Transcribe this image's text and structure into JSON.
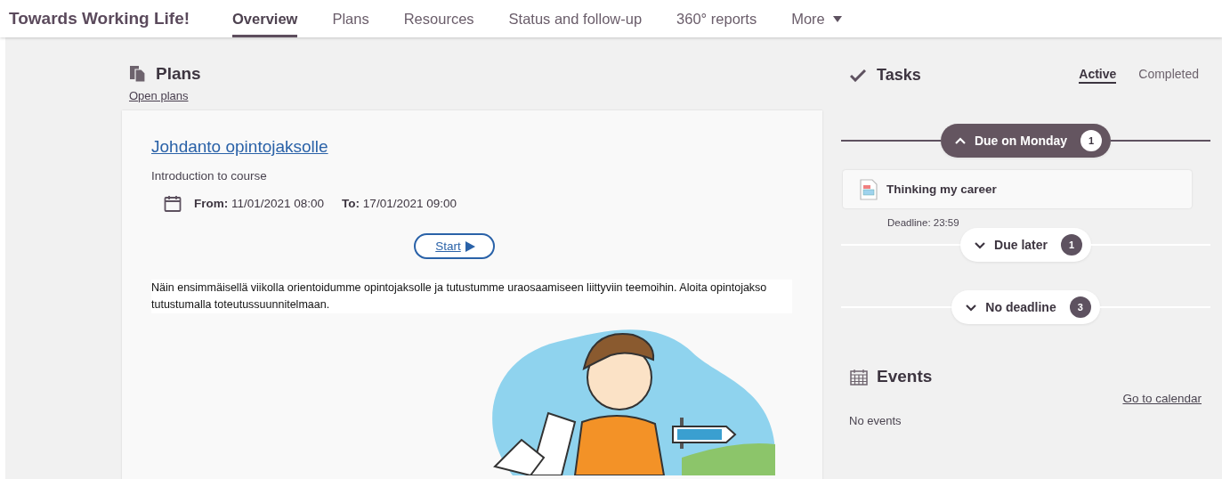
{
  "app_title": "Towards Working Life!",
  "nav": [
    {
      "label": "Overview",
      "selected": true,
      "kind": "link"
    },
    {
      "label": "Plans",
      "selected": false,
      "kind": "link"
    },
    {
      "label": "Resources",
      "selected": false,
      "kind": "link"
    },
    {
      "label": "Status and follow-up",
      "selected": false,
      "kind": "link"
    },
    {
      "label": "360° reports",
      "selected": false,
      "kind": "link"
    },
    {
      "label": "More",
      "selected": false,
      "kind": "menu"
    }
  ],
  "plans": {
    "title": "Plans",
    "open_link": "Open plans",
    "card": {
      "title": "Johdanto opintojaksolle",
      "subtitle": "Introduction to course",
      "from_label": "From:",
      "from": "11/01/2021 08:00",
      "to_label": "To:",
      "to": "17/01/2021 09:00",
      "start_button": "Start",
      "description": "Näin ensimmäisellä viikolla orientoidumme opintojaksolle ja tutustumme uraosaamiseen liittyviin teemoihin. Aloita opintojakso tutustumalla toteutussuunnitelmaan."
    }
  },
  "tasks": {
    "title": "Tasks",
    "tabs": [
      {
        "label": "Active",
        "selected": true
      },
      {
        "label": "Completed",
        "selected": false
      }
    ],
    "groups": [
      {
        "label": "Due on Monday",
        "count": "1",
        "expanded": true,
        "items": [
          {
            "title": "Thinking my career",
            "deadline": "Deadline: 23:59"
          }
        ]
      },
      {
        "label": "Due later",
        "count": "1",
        "expanded": false
      },
      {
        "label": "No deadline",
        "count": "3",
        "expanded": false
      }
    ]
  },
  "events": {
    "title": "Events",
    "calendar_link": "Go to calendar",
    "empty": "No events"
  }
}
